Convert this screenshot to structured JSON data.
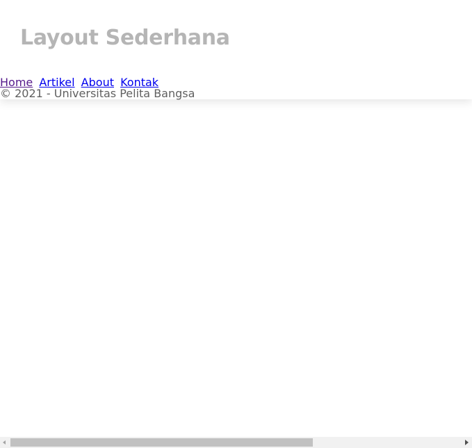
{
  "header": {
    "title": "Layout Sederhana"
  },
  "nav": {
    "items": [
      {
        "label": "Home"
      },
      {
        "label": "Artikel"
      },
      {
        "label": "About"
      },
      {
        "label": "Kontak"
      }
    ]
  },
  "footer": {
    "text": "© 2021 - Universitas Pelita Bangsa"
  },
  "scrollbar": {
    "horizontal_thumb_fraction": 0.67
  },
  "colors": {
    "title": "#b5b5b5",
    "link": "#0000ee",
    "visited_link": "#551a8b",
    "footer_text": "#5f5f5f"
  }
}
